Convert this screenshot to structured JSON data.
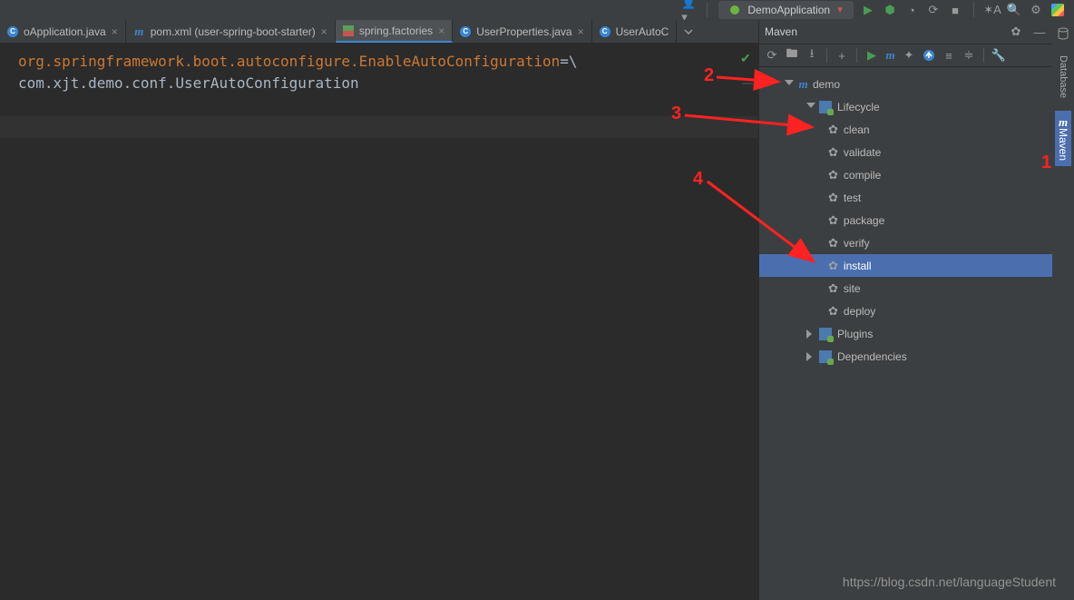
{
  "toolbar": {
    "run_config": "DemoApplication"
  },
  "tabs": [
    {
      "label": "oApplication.java",
      "icon": "java"
    },
    {
      "label": "pom.xml (user-spring-boot-starter)",
      "icon": "m"
    },
    {
      "label": "spring.factories",
      "icon": "props",
      "active": true
    },
    {
      "label": "UserProperties.java",
      "icon": "java"
    },
    {
      "label": "UserAutoC",
      "icon": "java"
    }
  ],
  "editor": {
    "line1_key": "org.springframework.boot.autoconfigure.EnableAutoConfiguration",
    "line1_eq": "=",
    "line1_bs": "\\",
    "line2": "com.xjt.demo.conf.UserAutoConfiguration"
  },
  "maven": {
    "title": "Maven",
    "project": "demo",
    "lifecycle_label": "Lifecycle",
    "goals": [
      "clean",
      "validate",
      "compile",
      "test",
      "package",
      "verify",
      "install",
      "site",
      "deploy"
    ],
    "plugins_label": "Plugins",
    "deps_label": "Dependencies"
  },
  "right_stripe": {
    "database": "Database",
    "maven": "Maven"
  },
  "annotations": {
    "n1": "1",
    "n2": "2",
    "n3": "3",
    "n4": "4"
  },
  "watermark": "https://blog.csdn.net/languageStudent"
}
